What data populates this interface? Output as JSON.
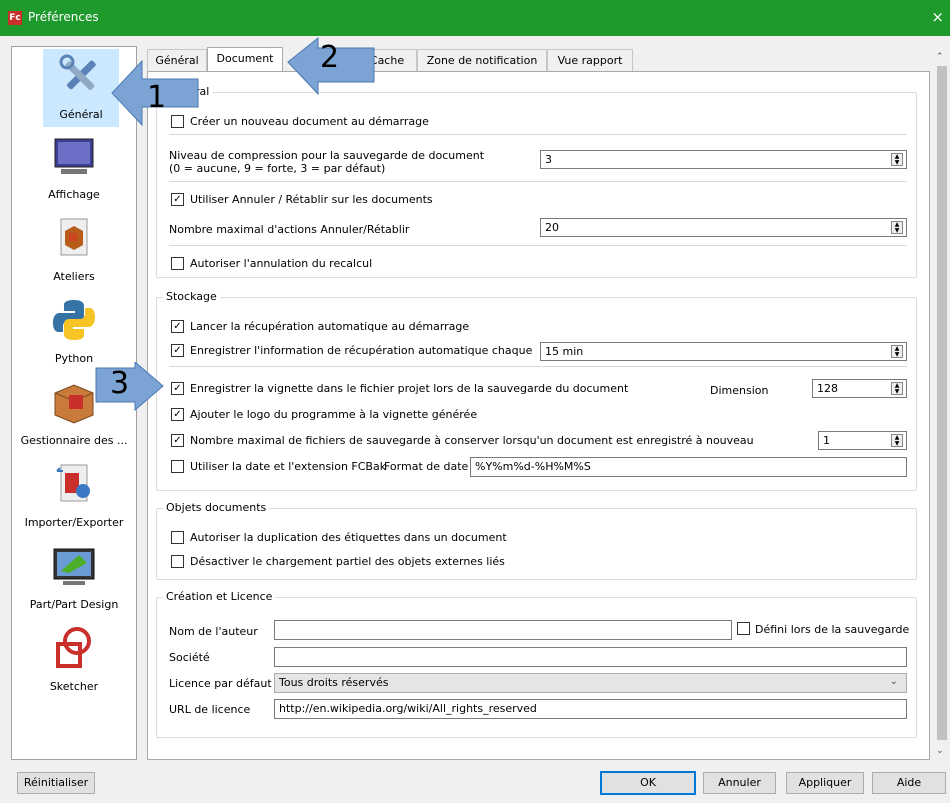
{
  "window": {
    "title": "Préférences",
    "close": "×"
  },
  "sidebar": {
    "items": [
      {
        "label": "Général"
      },
      {
        "label": "Affichage"
      },
      {
        "label": "Ateliers"
      },
      {
        "label": "Python"
      },
      {
        "label": "Gestionnaire des ..."
      },
      {
        "label": "Importer/Exporter"
      },
      {
        "label": "Part/Part Design"
      },
      {
        "label": "Sketcher"
      }
    ]
  },
  "tabs": [
    "Général",
    "Document",
    "Cache",
    "Zone de notification",
    "Vue rapport"
  ],
  "general": {
    "title": "Général",
    "create_new": "Créer un nouveau document au démarrage",
    "compression_label_1": "Niveau de compression pour la sauvegarde de document",
    "compression_label_2": "(0 = aucune, 9 = forte, 3 = par défaut)",
    "compression_value": "3",
    "undo_redo": "Utiliser Annuler / Rétablir sur les documents",
    "max_undo_label": "Nombre maximal d'actions Annuler/Rétablir",
    "max_undo_value": "20",
    "allow_recompute_undo": "Autoriser l'annulation du recalcul"
  },
  "storage": {
    "title": "Stockage",
    "auto_recovery": "Lancer la récupération automatique au démarrage",
    "save_recovery": "Enregistrer l'information de récupération automatique chaque",
    "save_recovery_value": "15 min",
    "thumbnail": "Enregistrer la vignette dans le fichier projet lors de la sauvegarde du document",
    "dimension_label": "Dimension",
    "dimension_value": "128",
    "add_logo": "Ajouter le logo du programme à la vignette générée",
    "max_backups": "Nombre maximal de fichiers de sauvegarde à conserver lorsqu'un document est enregistré à nouveau",
    "max_backups_value": "1",
    "use_date": "Utiliser la date et l'extension FCBak",
    "date_format_label": "Format de date",
    "date_format_value": "%Y%m%d-%H%M%S"
  },
  "objects": {
    "title": "Objets documents",
    "dup_labels": "Autoriser la duplication des étiquettes dans un document",
    "partial_load": "Désactiver le chargement partiel des objets externes liés"
  },
  "license": {
    "title": "Création et Licence",
    "author_label": "Nom de l'auteur",
    "author_value": "",
    "set_on_save": "Défini lors de la sauvegarde",
    "company_label": "Société",
    "company_value": "",
    "default_license_label": "Licence par défaut",
    "default_license_value": "Tous droits réservés",
    "license_url_label": "URL de licence",
    "license_url_value": "http://en.wikipedia.org/wiki/All_rights_reserved"
  },
  "buttons": {
    "reset": "Réinitialiser",
    "ok": "OK",
    "cancel": "Annuler",
    "apply": "Appliquer",
    "help": "Aide"
  },
  "callouts": [
    "1",
    "2",
    "3"
  ],
  "colors": {
    "titlebar": "#1e9a2c",
    "callout": "#7ba3d4",
    "selection": "#cce8ff"
  }
}
